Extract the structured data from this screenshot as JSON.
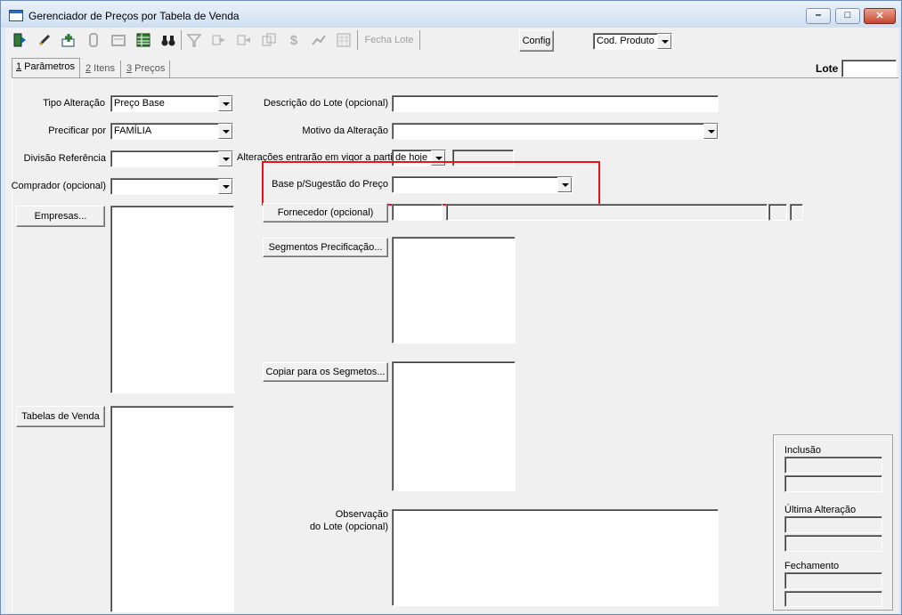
{
  "window": {
    "title": "Gerenciador de Preços por Tabela de Venda",
    "minimize_glyph": "‒",
    "maximize_glyph": "□",
    "close_glyph": "✕"
  },
  "toolbar": {
    "icons": [
      "exit-icon",
      "edit-icon",
      "new-record-icon",
      "attach-icon",
      "save-icon",
      "spreadsheet-icon",
      "binoculars-icon",
      "filter-icon",
      "map-in-icon",
      "map-out-icon",
      "copy-icon",
      "price-icon",
      "chart-trend-icon",
      "grid-icon"
    ],
    "close_batch_label": "Fecha Lote",
    "config_label": "Config",
    "sort_select_value": "Cod. Produto"
  },
  "tabs": [
    {
      "num": "1",
      "label": " Parâmetros"
    },
    {
      "num": "2",
      "label": " Itens"
    },
    {
      "num": "3",
      "label": " Preços"
    }
  ],
  "lote": {
    "label": "Lote",
    "value": ""
  },
  "left": {
    "tipo_alteracao_label": "Tipo Alteração",
    "tipo_alteracao_value": "Preço Base",
    "precificar_por_label": "Precificar por",
    "precificar_por_value": "FAMÍLIA",
    "divisao_label": "Divisão Referência",
    "divisao_value": "",
    "comprador_label": "Comprador (opcional)",
    "comprador_value": "",
    "empresas_button": "Empresas...",
    "tabelas_button": "Tabelas de Venda"
  },
  "right": {
    "descricao_label": "Descrição do Lote (opcional)",
    "descricao_value": "",
    "motivo_label": "Motivo da Alteração",
    "motivo_value": "",
    "vigor_label": "Alterações entrarão em vigor a partir",
    "vigor_value": "de hoje",
    "base_label": "Base p/Sugestão do Preço",
    "base_value": "",
    "fornecedor_button": "Fornecedor (opcional)",
    "segmentos_button": "Segmentos Precificação...",
    "copiar_button": "Copiar para os Segmetos...",
    "observacao_label_1": "Observação",
    "observacao_label_2": "do Lote (opcional)",
    "observacao_value": ""
  },
  "audit": {
    "inclusao_label": "Inclusão",
    "ultima_label": "Última Alteração",
    "fechamento_label": "Fechamento"
  },
  "colors": {
    "highlight": "#e8141c"
  }
}
